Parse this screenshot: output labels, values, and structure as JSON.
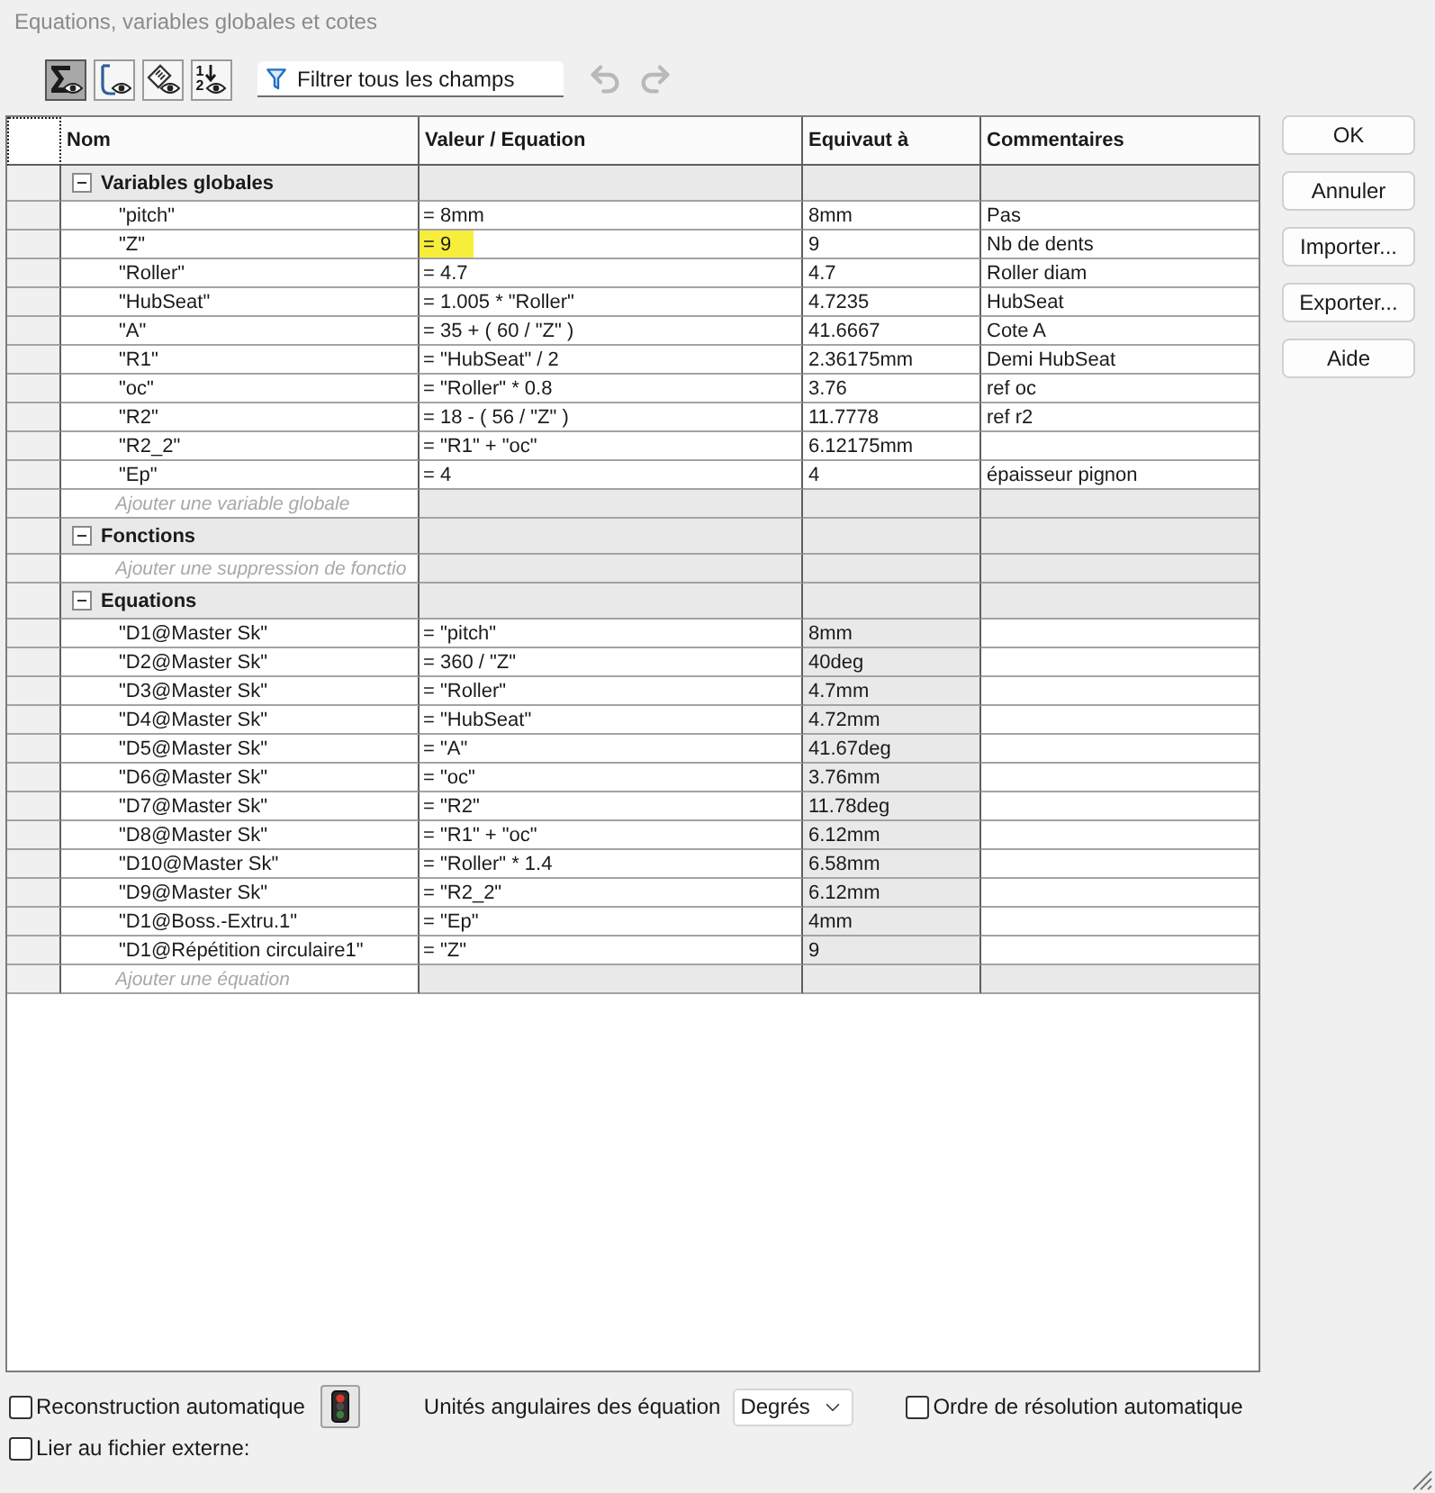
{
  "window": {
    "title": "Equations, variables globales et cotes"
  },
  "toolbar": {
    "view_buttons": [
      {
        "kind": "equations",
        "selected": true
      },
      {
        "kind": "sketch",
        "selected": false
      },
      {
        "kind": "dimensions",
        "selected": false
      },
      {
        "kind": "ordered",
        "selected": false,
        "digits": [
          "1",
          "2"
        ]
      }
    ],
    "filter": {
      "placeholder": "Filtrer tous les champs"
    },
    "undo": {
      "disabled": true
    },
    "redo": {
      "disabled": true
    }
  },
  "table": {
    "columns": [
      "Nom",
      "Valeur / Equation",
      "Equivaut à",
      "Commentaires"
    ],
    "groups": [
      {
        "kind": "variables",
        "title": "Variables globales",
        "expanded": true,
        "rows": [
          {
            "name": "\"pitch\"",
            "value": "= 8mm",
            "equivalent": "8mm",
            "comment": "Pas",
            "highlighted": false
          },
          {
            "name": "\"Z\"",
            "value": "= 9",
            "equivalent": "9",
            "comment": "Nb de dents",
            "highlighted": true
          },
          {
            "name": "\"Roller\"",
            "value": "= 4.7",
            "equivalent": "4.7",
            "comment": "Roller diam",
            "highlighted": false
          },
          {
            "name": "\"HubSeat\"",
            "value": "= 1.005 * \"Roller\"",
            "equivalent": "4.7235",
            "comment": "HubSeat",
            "highlighted": false
          },
          {
            "name": "\"A\"",
            "value": "= 35 + ( 60 / \"Z\" )",
            "equivalent": "41.6667",
            "comment": "Cote A",
            "highlighted": false
          },
          {
            "name": "\"R1\"",
            "value": "= \"HubSeat\" / 2",
            "equivalent": "2.36175mm",
            "comment": "Demi HubSeat",
            "highlighted": false
          },
          {
            "name": "\"oc\"",
            "value": "= \"Roller\" * 0.8",
            "equivalent": "3.76",
            "comment": "ref oc",
            "highlighted": false
          },
          {
            "name": "\"R2\"",
            "value": "= 18 - ( 56 / \"Z\" )",
            "equivalent": "11.7778",
            "comment": "ref r2",
            "highlighted": false
          },
          {
            "name": "\"R2_2\"",
            "value": "= \"R1\" + \"oc\"",
            "equivalent": "6.12175mm",
            "highlighted": false
          },
          {
            "name": "\"Ep\"",
            "value": "= 4",
            "equivalent": "4",
            "comment": "épaisseur pignon",
            "highlighted": false
          }
        ],
        "add_placeholder": "Ajouter une variable globale"
      },
      {
        "kind": "functions",
        "title": "Fonctions",
        "expanded": true,
        "add_placeholder": "Ajouter une suppression de fonctio"
      },
      {
        "kind": "equations",
        "title": "Equations",
        "expanded": true,
        "rows": [
          {
            "name": "\"D1@Master Sk\"",
            "value": "= \"pitch\"",
            "equivalent": "8mm"
          },
          {
            "name": "\"D2@Master Sk\"",
            "value": "= 360 / \"Z\"",
            "equivalent": "40deg"
          },
          {
            "name": "\"D3@Master Sk\"",
            "value": "= \"Roller\"",
            "equivalent": "4.7mm"
          },
          {
            "name": "\"D4@Master Sk\"",
            "value": "= \"HubSeat\"",
            "equivalent": "4.72mm"
          },
          {
            "name": "\"D5@Master Sk\"",
            "value": "= \"A\"",
            "equivalent": "41.67deg"
          },
          {
            "name": "\"D6@Master Sk\"",
            "value": "= \"oc\"",
            "equivalent": "3.76mm"
          },
          {
            "name": "\"D7@Master Sk\"",
            "value": "= \"R2\"",
            "equivalent": "11.78deg"
          },
          {
            "name": "\"D8@Master Sk\"",
            "value": "= \"R1\" + \"oc\"",
            "equivalent": "6.12mm"
          },
          {
            "name": "\"D10@Master Sk\"",
            "value": "= \"Roller\" * 1.4",
            "equivalent": "6.58mm"
          },
          {
            "name": "\"D9@Master Sk\"",
            "value": "= \"R2_2\"",
            "equivalent": "6.12mm"
          },
          {
            "name": "\"D1@Boss.-Extru.1\"",
            "value": "= \"Ep\"",
            "equivalent": "4mm"
          },
          {
            "name": "\"D1@Répétition circulaire1\"",
            "value": "= \"Z\"",
            "equivalent": "9"
          }
        ],
        "add_placeholder": "Ajouter une équation"
      }
    ]
  },
  "side_buttons": [
    "OK",
    "Annuler",
    "Importer...",
    "Exporter...",
    "Aide"
  ],
  "options": {
    "auto_rebuild": {
      "label": "Reconstruction automatique",
      "checked": false
    },
    "angle_units": {
      "label": "Unités angulaires des équation",
      "value": "Degrés"
    },
    "auto_order": {
      "label": "Ordre de résolution automatique",
      "checked": false
    },
    "link_file": {
      "label": "Lier au fichier externe:",
      "checked": false
    }
  }
}
